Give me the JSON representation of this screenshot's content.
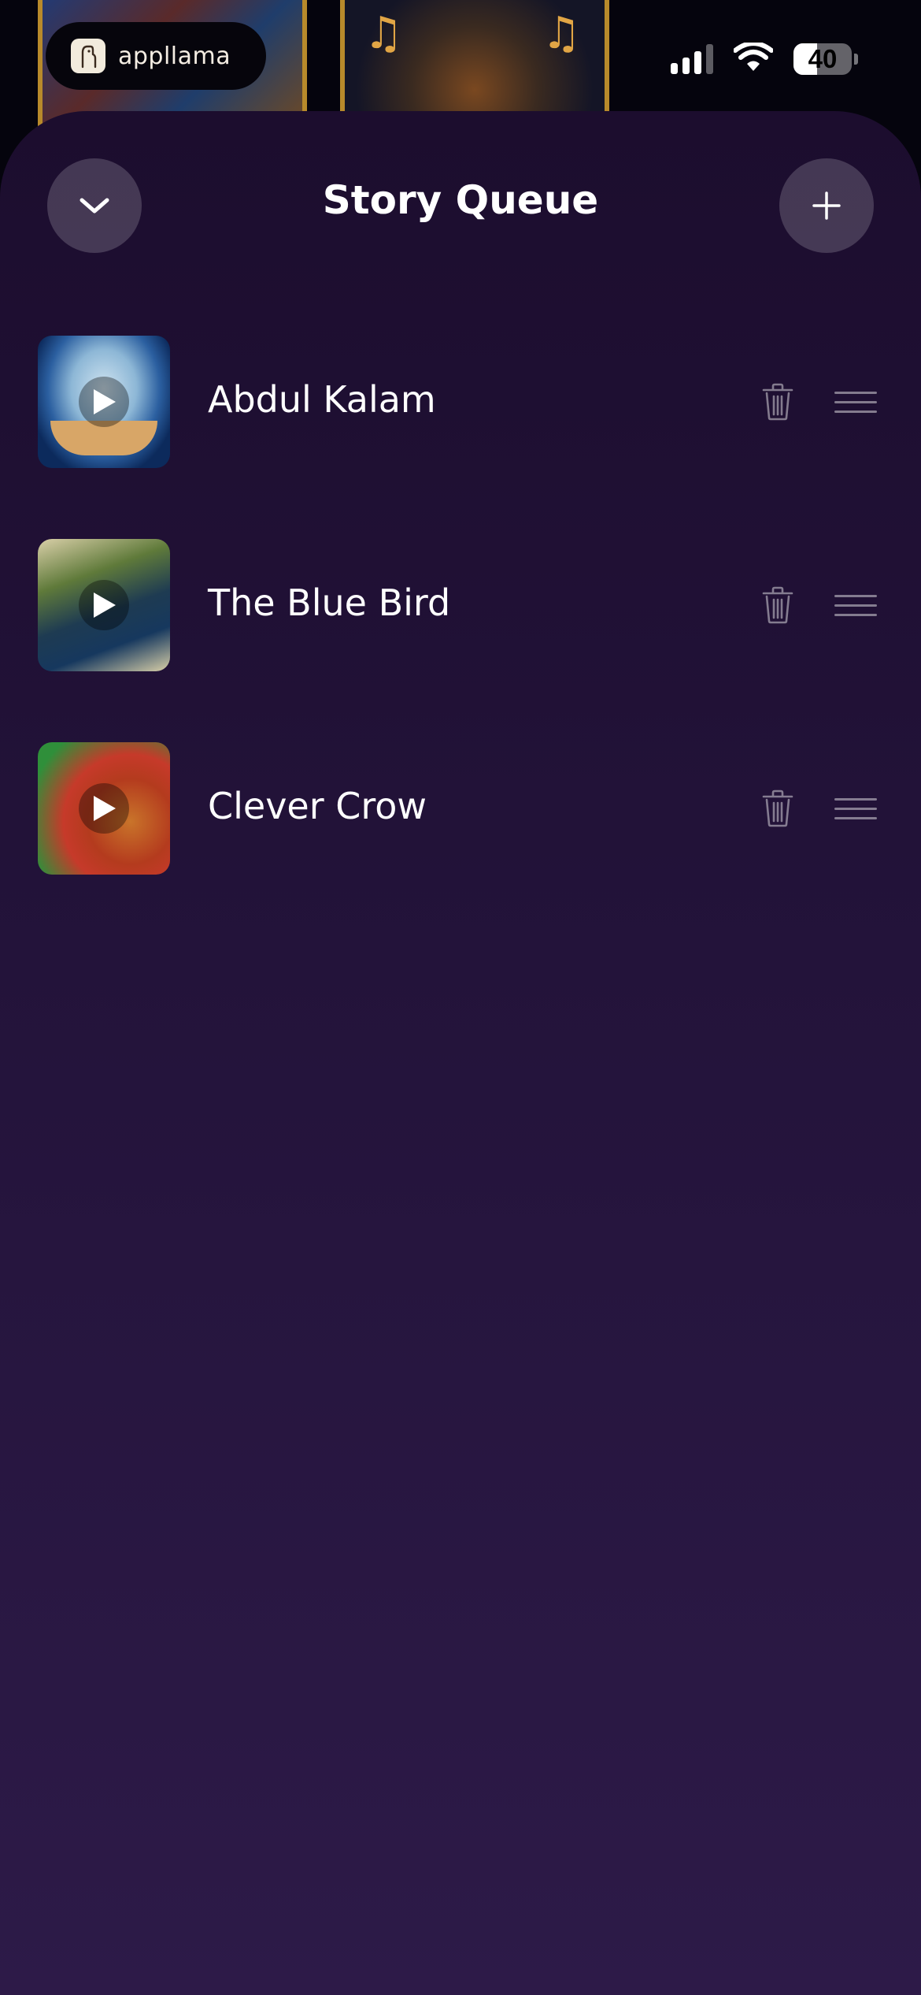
{
  "status_bar": {
    "brand_name": "appllama",
    "battery_level": "40",
    "battery_fraction": 0.4,
    "signal_bars": 4,
    "signal_active_bars": 3
  },
  "sheet": {
    "title": "Story Queue",
    "collapse_icon": "chevron-down-icon",
    "add_icon": "plus-icon"
  },
  "queue": [
    {
      "title": "Abdul Kalam",
      "thumb_icon": "play-icon"
    },
    {
      "title": "The Blue Bird",
      "thumb_icon": "play-icon"
    },
    {
      "title": "Clever Crow",
      "thumb_icon": "play-icon"
    }
  ],
  "colors": {
    "sheet_top": "#1c0d2e",
    "sheet_bottom": "#2d1a48",
    "button_bg": "rgba(255,255,255,0.18)",
    "muted_icon": "rgba(255,255,255,0.45)"
  }
}
